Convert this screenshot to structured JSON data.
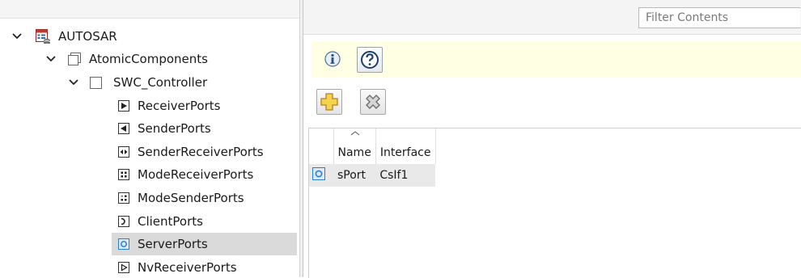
{
  "tree": {
    "nodes": [
      {
        "label": "AUTOSAR",
        "icon": "autosar-icon",
        "expanded": true
      },
      {
        "label": "AtomicComponents",
        "icon": "components-folder-icon",
        "expanded": true
      },
      {
        "label": "SWC_Controller",
        "icon": "component-icon",
        "expanded": true
      },
      {
        "label": "ReceiverPorts",
        "icon": "receiver-port-icon"
      },
      {
        "label": "SenderPorts",
        "icon": "sender-port-icon"
      },
      {
        "label": "SenderReceiverPorts",
        "icon": "sender-receiver-port-icon"
      },
      {
        "label": "ModeReceiverPorts",
        "icon": "mode-receiver-port-icon"
      },
      {
        "label": "ModeSenderPorts",
        "icon": "mode-sender-port-icon"
      },
      {
        "label": "ClientPorts",
        "icon": "client-port-icon"
      },
      {
        "label": "ServerPorts",
        "icon": "server-port-icon",
        "selected": true
      },
      {
        "label": "NvReceiverPorts",
        "icon": "nv-receiver-port-icon"
      }
    ]
  },
  "filter": {
    "placeholder": "Filter Contents"
  },
  "table": {
    "columns": [
      "Name",
      "Interface"
    ],
    "rows": [
      {
        "name": "sPort",
        "interface": "CsIf1"
      }
    ]
  },
  "colors": {
    "info_bar": "#ffffe3",
    "selection": "#dadada",
    "server_port_blue": "#2f7fd0"
  }
}
